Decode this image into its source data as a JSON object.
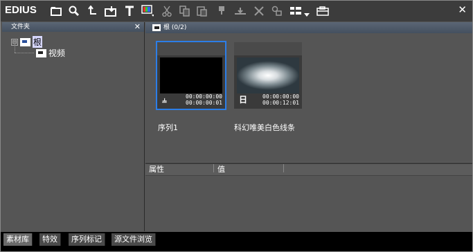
{
  "app": {
    "logo": "EDIUS"
  },
  "toolbar": {
    "icons": [
      "new-bin-icon",
      "search-icon",
      "up-level-icon",
      "import-icon",
      "title-icon",
      "color-bar-icon",
      "cut-icon",
      "copy-icon",
      "paste-icon",
      "add-to-timeline-icon",
      "insert-to-timeline-icon",
      "delete-icon",
      "properties-icon",
      "view-icon",
      "dropdown-icon",
      "open-folder-icon"
    ]
  },
  "left_panel": {
    "title": "文件夹",
    "tree": [
      {
        "label": "根",
        "expander": "⊟"
      },
      {
        "label": "视频"
      }
    ]
  },
  "bin": {
    "title": "根 (0/2)",
    "clips": [
      {
        "name": "序列1",
        "tc_in": "00:00:00:00",
        "tc_out": "00:00:00:01",
        "type_icon": "⫨"
      },
      {
        "name": "科幻唯美白色线条",
        "tc_in": "00:00:00:00",
        "tc_out": "00:00:12:01",
        "type_icon": "⽇"
      }
    ]
  },
  "properties": {
    "col_attribute": "属性",
    "col_value": "值"
  },
  "tabs": [
    {
      "label": "素材库",
      "active": true
    },
    {
      "label": "特效",
      "active": false
    },
    {
      "label": "序列标记",
      "active": false
    },
    {
      "label": "源文件浏览",
      "active": false
    }
  ]
}
